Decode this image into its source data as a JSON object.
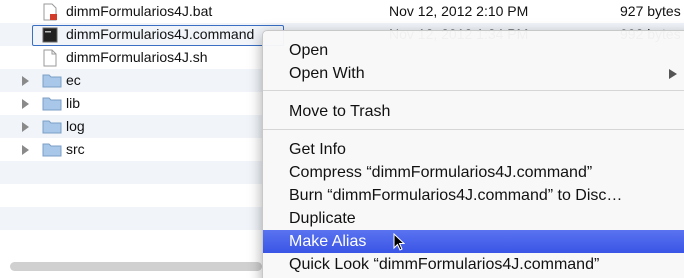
{
  "files": [
    {
      "name": "dimmFormularios4J.bat",
      "date": "Nov 12, 2012 2:10 PM",
      "size": "927 bytes",
      "icon": "bat-file-icon"
    },
    {
      "name": "dimmFormularios4J.command",
      "date": "Nov 12, 2012 1:34 PM",
      "size": "992 bytes",
      "icon": "terminal-file-icon"
    },
    {
      "name": "dimmFormularios4J.sh",
      "date": "",
      "size": "",
      "icon": "document-icon"
    },
    {
      "name": "ec",
      "date": "",
      "size": "",
      "icon": "folder-icon"
    },
    {
      "name": "lib",
      "date": "",
      "size": "",
      "icon": "folder-icon"
    },
    {
      "name": "log",
      "date": "",
      "size": "",
      "icon": "folder-icon"
    },
    {
      "name": "src",
      "date": "",
      "size": "",
      "icon": "folder-icon"
    }
  ],
  "menu": {
    "open": "Open",
    "open_with": "Open With",
    "move_to_trash": "Move to Trash",
    "get_info": "Get Info",
    "compress": "Compress “dimmFormularios4J.command”",
    "burn": "Burn “dimmFormularios4J.command” to Disc…",
    "duplicate": "Duplicate",
    "make_alias": "Make Alias",
    "quick_look": "Quick Look “dimmFormularios4J.command”"
  },
  "colors": {
    "selection_outline": "#3a6fc4",
    "menu_highlight": "#3a55e6",
    "row_alt": "#f1f5fa"
  }
}
